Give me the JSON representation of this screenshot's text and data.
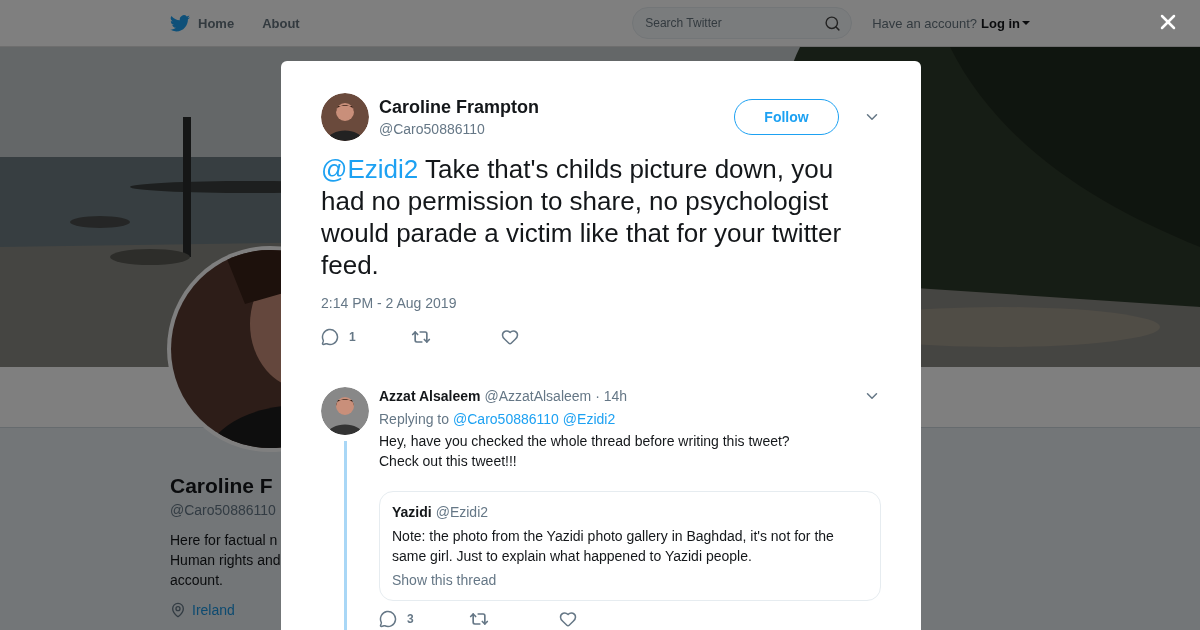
{
  "nav": {
    "items": [
      {
        "label": "Home",
        "kind": "logo"
      },
      {
        "label": "About",
        "kind": "plain"
      }
    ],
    "search": {
      "placeholder": "Search Twitter"
    },
    "account_prompt": "Have an account?",
    "login": "Log in"
  },
  "profile": {
    "name": "Caroline F",
    "handle": "@Caro50886110",
    "bio_lines": [
      "Here for factual n",
      "Human rights and",
      "account."
    ],
    "location": "Ireland"
  },
  "tweet": {
    "name": "Caroline Frampton",
    "handle": "@Caro50886110",
    "follow": "Follow",
    "mention": "@Ezidi2",
    "text": "Take that's childs picture down, you had no permission to share, no psychologist would parade a victim like that for your twitter feed.",
    "time": "2:14 PM - 2 Aug 2019",
    "reply_count": "1"
  },
  "replies": [
    {
      "name": "Azzat Alsaleem",
      "handle": "@AzzatAlsaleem",
      "age": "· 14h",
      "replying_label": "Replying to",
      "mentions": [
        "@Caro50886110",
        "@Ezidi2"
      ],
      "text_lines": [
        "Hey, have you checked the whole thread before writing this tweet?",
        "Check out this tweet!!!"
      ],
      "quote": {
        "name": "Yazidi",
        "handle": "@Ezidi2",
        "text": "Note: the photo from the Yazidi photo gallery in Baghdad, it's not for the same girl. Just to explain what happened to Yazidi people.",
        "show_thread": "Show this thread"
      },
      "reply_count": "3"
    }
  ]
}
